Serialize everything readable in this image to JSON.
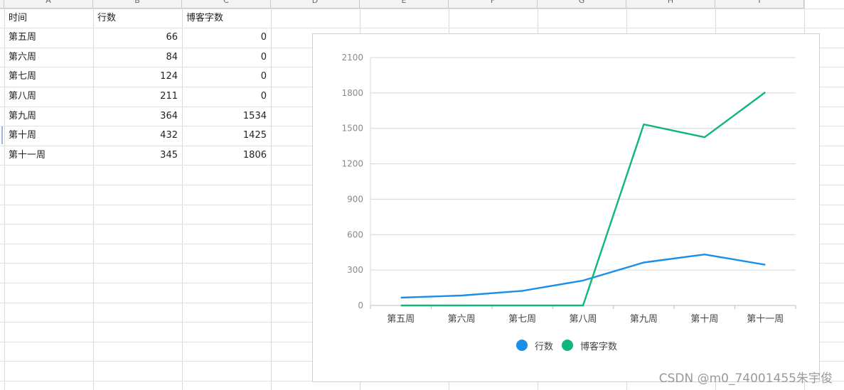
{
  "sheet": {
    "column_headers": [
      "A",
      "B",
      "C",
      "D",
      "E",
      "F",
      "G",
      "H",
      "I"
    ],
    "table": {
      "headers": [
        "时间",
        "行数",
        "博客字数"
      ],
      "rows": [
        [
          "第五周",
          "66",
          "0"
        ],
        [
          "第六周",
          "84",
          "0"
        ],
        [
          "第七周",
          "124",
          "0"
        ],
        [
          "第八周",
          "211",
          "0"
        ],
        [
          "第九周",
          "364",
          "1534"
        ],
        [
          "第十周",
          "432",
          "1425"
        ],
        [
          "第十一周",
          "345",
          "1806"
        ]
      ]
    }
  },
  "chart_data": {
    "type": "line",
    "categories": [
      "第五周",
      "第六周",
      "第七周",
      "第八周",
      "第九周",
      "第十周",
      "第十一周"
    ],
    "series": [
      {
        "name": "行数",
        "values": [
          66,
          84,
          124,
          211,
          364,
          432,
          345
        ],
        "color": "#1a8fea"
      },
      {
        "name": "博客字数",
        "values": [
          0,
          0,
          0,
          0,
          1534,
          1425,
          1806
        ],
        "color": "#10b67a"
      }
    ],
    "yticks": [
      0,
      300,
      600,
      900,
      1200,
      1500,
      1800,
      2100
    ],
    "ylim": [
      0,
      2100
    ],
    "grid": true,
    "legend_position": "bottom"
  },
  "watermark": "CSDN @m0_74001455朱宇俊"
}
